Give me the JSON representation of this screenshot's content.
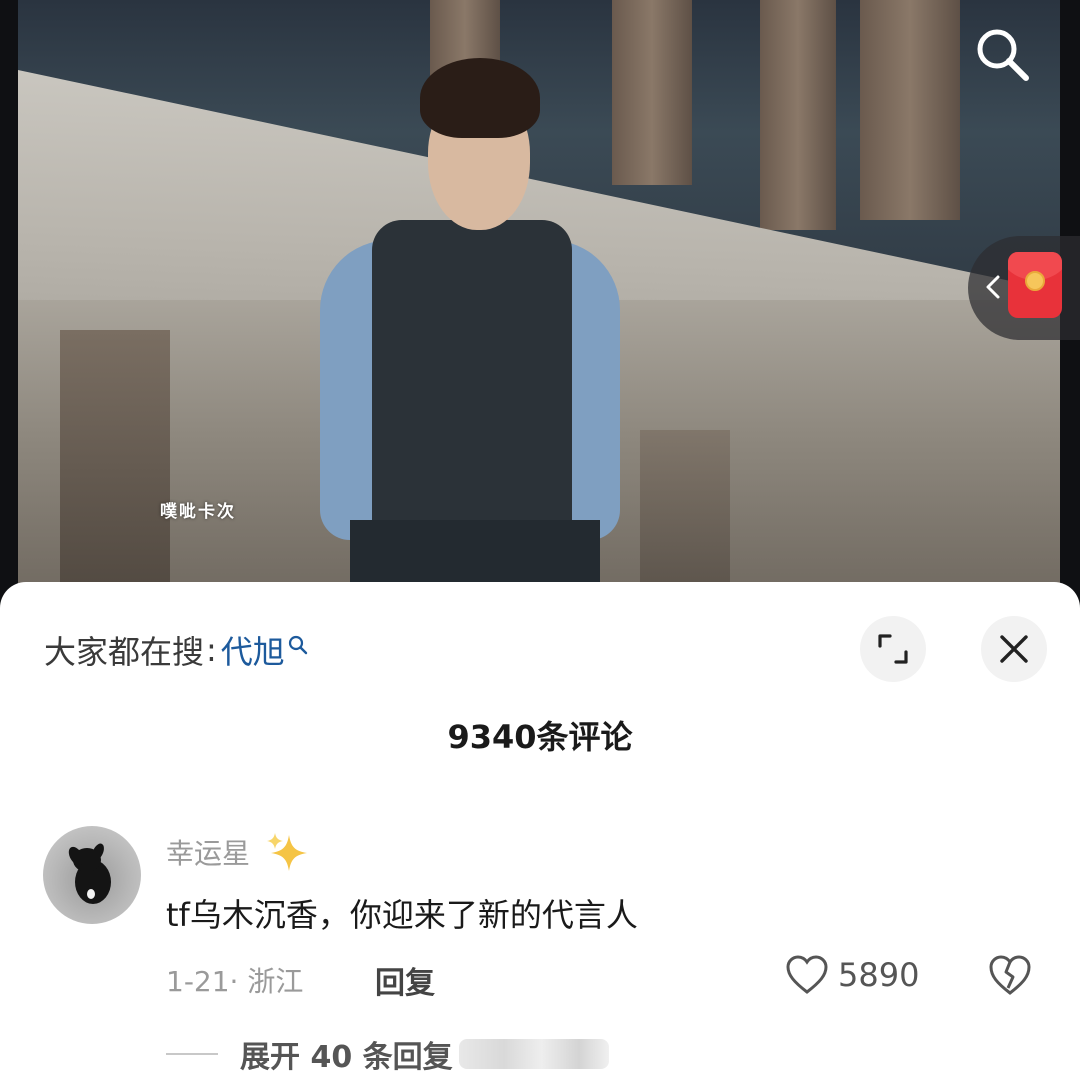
{
  "video": {
    "watermark": "噗呲卡次",
    "search_icon": "search-icon",
    "red_packet_icon": "red-packet-icon"
  },
  "sheet": {
    "trending_prefix": "大家都在搜",
    "trending_colon": ":",
    "trending_term": "代旭",
    "comment_count": "9340条评论",
    "expand_icon": "expand-icon",
    "close_icon": "close-icon"
  },
  "comment": {
    "username": "幸运星",
    "text": "tf乌木沉香，你迎来了新的代言人",
    "meta": "1-21· 浙江",
    "reply_label": "回复",
    "likes": "5890",
    "expand_replies_label": "展开 40 条回复"
  },
  "colors": {
    "link_blue": "#1d5a9c",
    "secondary_text": "#9a9a9a",
    "red_packet": "#e8323a"
  }
}
